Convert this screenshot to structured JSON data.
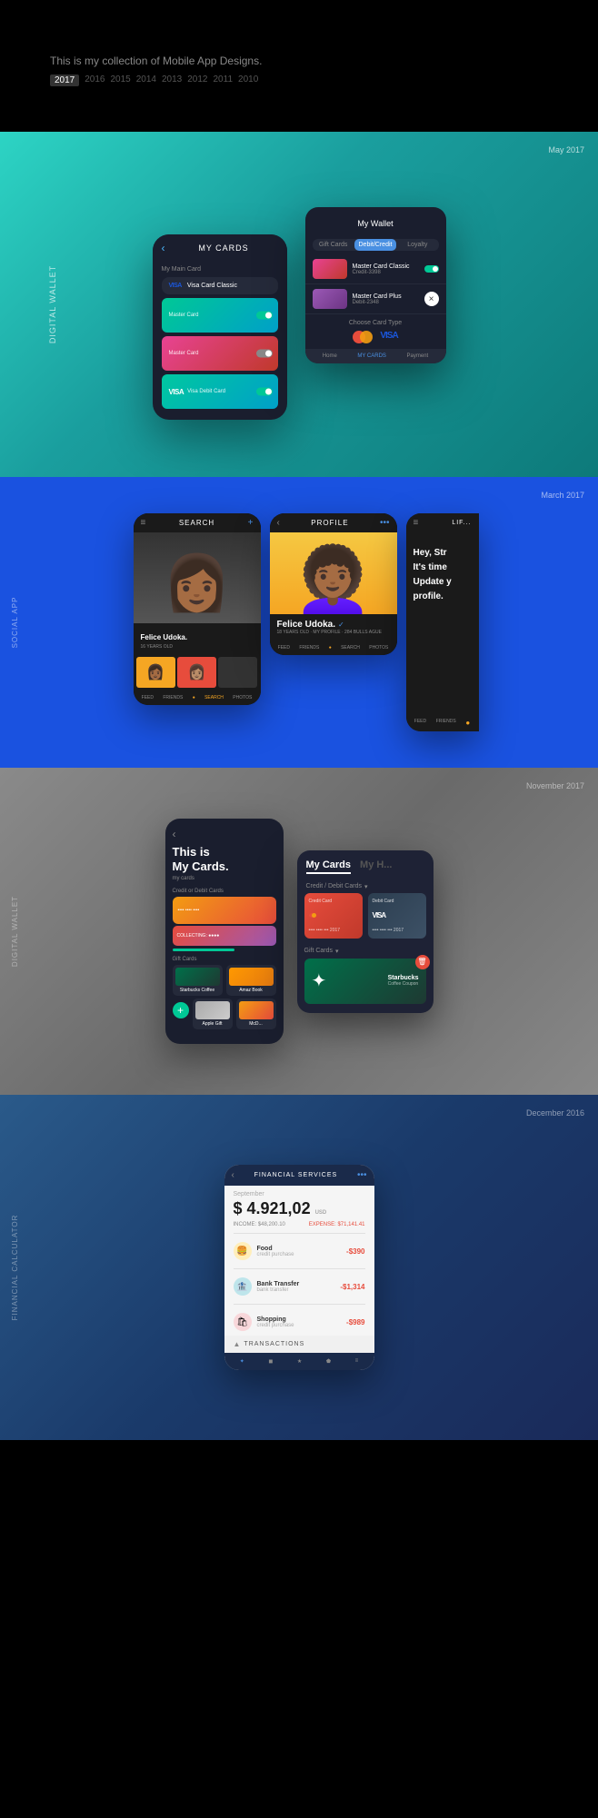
{
  "hero": {
    "description": "This is my collection of Mobile App Designs.",
    "years": [
      "2017",
      "2016",
      "2015",
      "2014",
      "2013",
      "2012",
      "2011",
      "2010"
    ],
    "active_year": "2017"
  },
  "section1": {
    "label": "Digital Wallet",
    "date": "May 2017",
    "title": "My Cards",
    "back_label": "‹",
    "main_card_label": "My Main Card",
    "visa_label": "VISA",
    "visa_card_name": "Visa Card Classic",
    "master_card": "Master Card",
    "visa_debit": "Visa Debit Card"
  },
  "wallet_popup": {
    "title": "My Wallet",
    "tabs": [
      "Gift Cards",
      "Debit/Credit",
      "Loyalty"
    ],
    "active_tab": "Debit/Credit",
    "card1_name": "Master Card Classic",
    "card1_num": "Credit-3398",
    "card2_name": "Master Card Plus",
    "card2_num": "Debit-2348",
    "choose_label": "Choose Card Type",
    "nav_items": [
      "Home",
      "MY CARDS",
      "Payment"
    ]
  },
  "section2": {
    "label": "Social App",
    "date": "March 2017",
    "person_name": "Felice Udoka.",
    "profile_name": "Felice Udoka.",
    "profile_verified": "✓",
    "profile_stats": "18 YEARS OLD · MY PROFILE · 284 BULLS AGUE",
    "nav_items": [
      "FEED",
      "FRIENDS",
      "SEARCH",
      "PHOTOS"
    ],
    "hey_text": "Hey, Str\nIt's time\nUpdate y\nprofile.",
    "search_title": "SEARCH",
    "profile_title": "PROFILE",
    "life_title": "LIFE"
  },
  "section3": {
    "label": "Digital Wallet",
    "date": "November 2017",
    "my_cards_title": "My",
    "my_cards_subtitle": "Cards",
    "this_is": "This is",
    "my_cards_text": "My Cards.",
    "credit_debit": "Credit / Debit Cards",
    "gift_cards": "Gift Cards",
    "starbucks": "Starbucks Coffee",
    "amazon": "Amazon Books",
    "apple": "Apple Gift",
    "mcdo": "McDonald's"
  },
  "section4": {
    "label": "Financial Calculator",
    "date": "December 2016",
    "app_title": "FINANCIAL SERVICES",
    "month": "September",
    "amount": "$ 4.921,02",
    "amount_sub": "USD",
    "income_label": "INCOME",
    "income_val": "$48,200.10",
    "expense_label": "EXPENSE",
    "expense_val": "$71,141.41",
    "transactions": [
      {
        "icon": "🍔",
        "name": "Food",
        "date": "credit purchase",
        "amount": "-$390",
        "type": "neg"
      },
      {
        "icon": "🏦",
        "name": "Bank Transfer",
        "date": "bank transfer",
        "amount": "-$1,314",
        "type": "neg"
      },
      {
        "icon": "🛍",
        "name": "Shopping",
        "date": "credit purchase",
        "amount": "-$989",
        "type": "neg"
      }
    ],
    "transactions_label": "TRANSACTIONS",
    "nav_items": [
      "✦",
      "◼",
      "★",
      "⬟",
      "≡"
    ]
  }
}
